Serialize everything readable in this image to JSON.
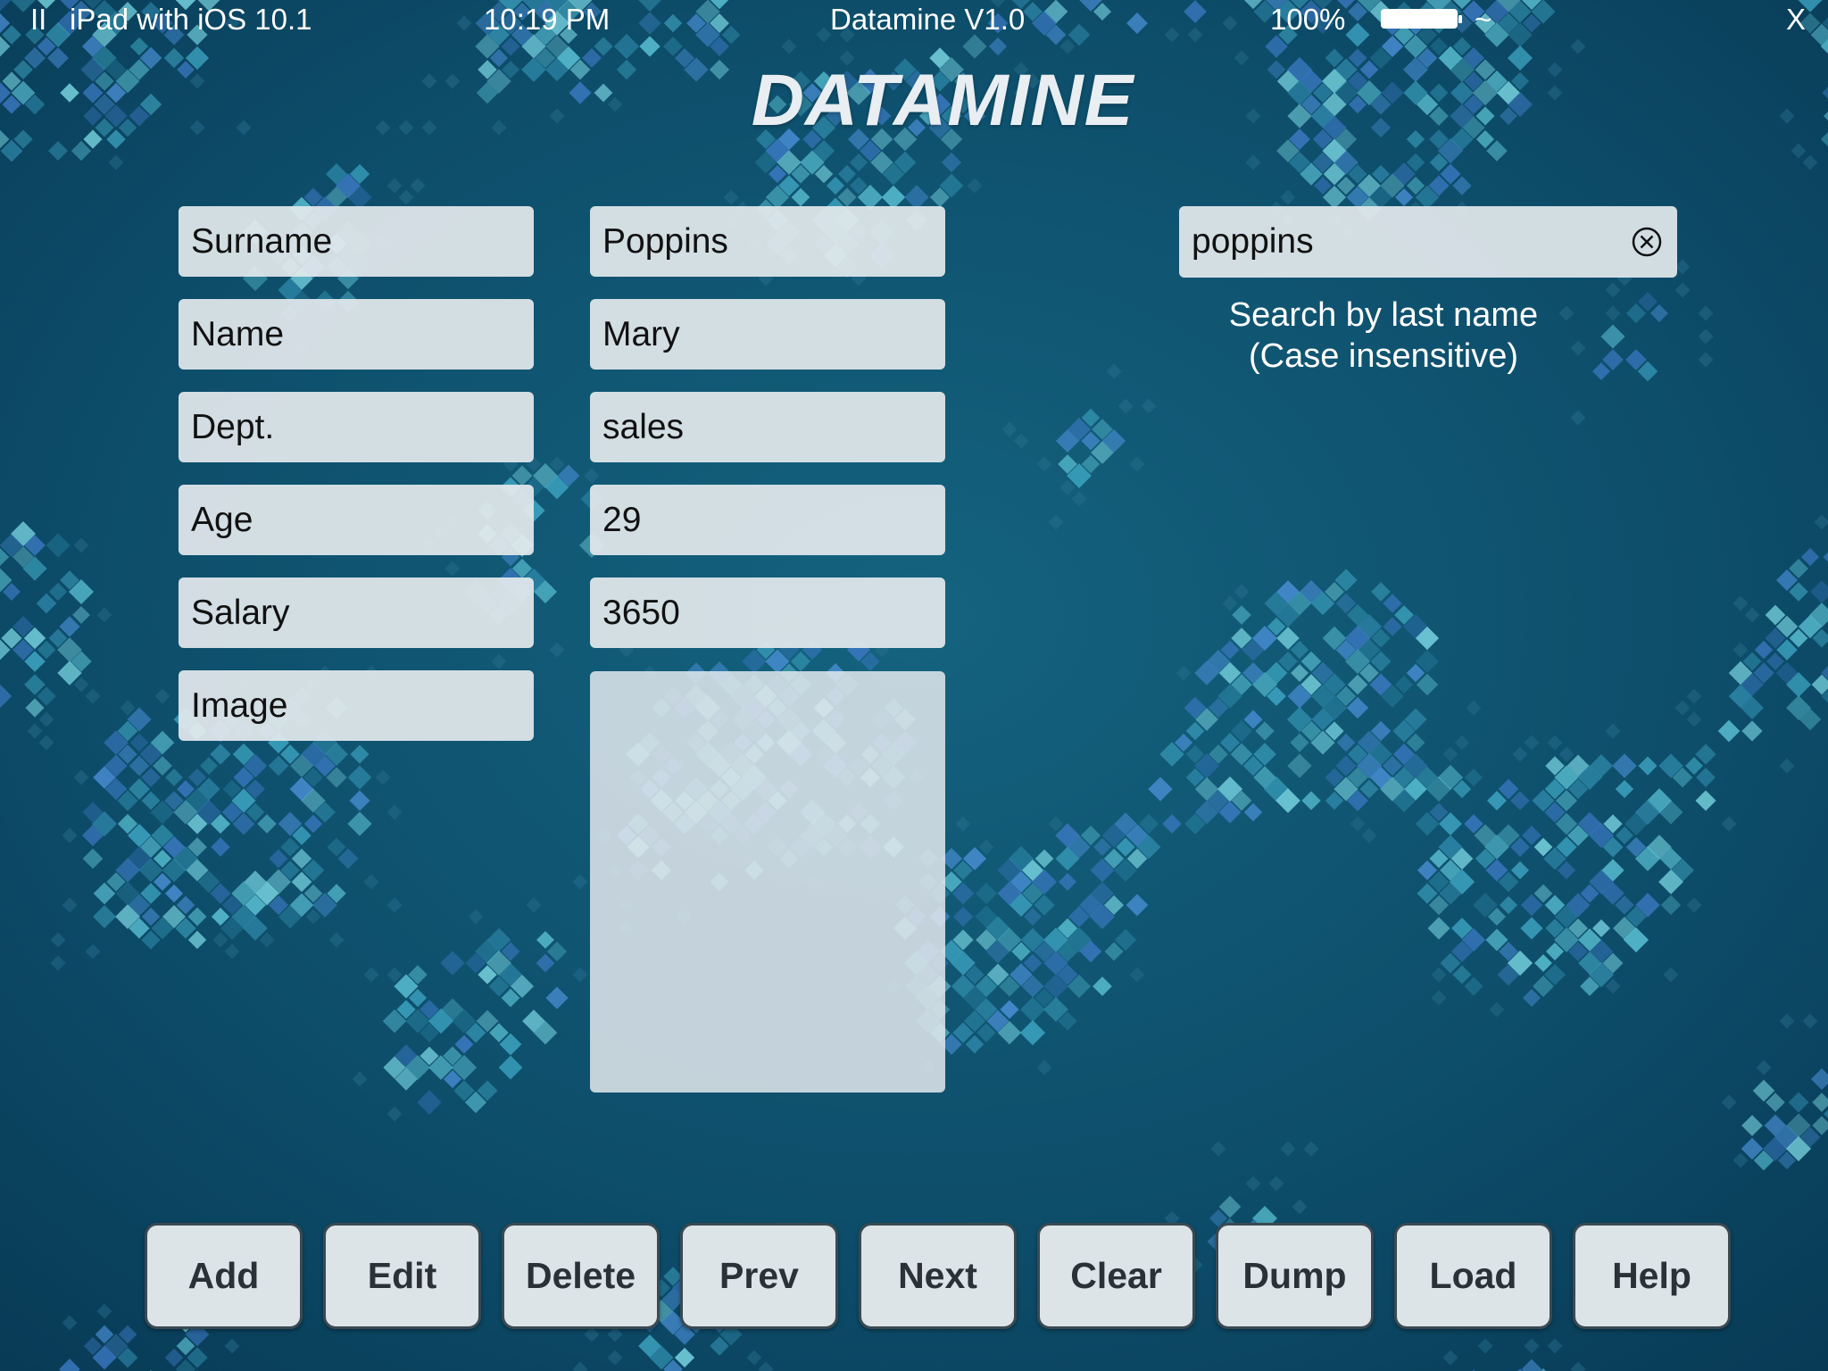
{
  "status_bar": {
    "pause_glyph": "II",
    "device": "iPad with iOS 10.1",
    "time": "10:19 PM",
    "app_title": "Datamine V1.0",
    "battery_percent": "100%",
    "wifi_glyph": "~",
    "close_glyph": "X"
  },
  "logo": "DATAMINE",
  "form": {
    "labels": [
      "Surname",
      "Name",
      "Dept.",
      "Age",
      "Salary",
      "Image"
    ],
    "values": [
      "Poppins",
      "Mary",
      "sales",
      "29",
      "3650"
    ]
  },
  "search": {
    "value": "poppins",
    "hint_line1": "Search by last name",
    "hint_line2": "(Case insensitive)"
  },
  "toolbar": {
    "buttons": [
      "Add",
      "Edit",
      "Delete",
      "Prev",
      "Next",
      "Clear",
      "Dump",
      "Load",
      "Help"
    ]
  },
  "colors": {
    "background": "#0d4f6e",
    "field": "#e2e8ec",
    "button": "#dde4e8"
  }
}
